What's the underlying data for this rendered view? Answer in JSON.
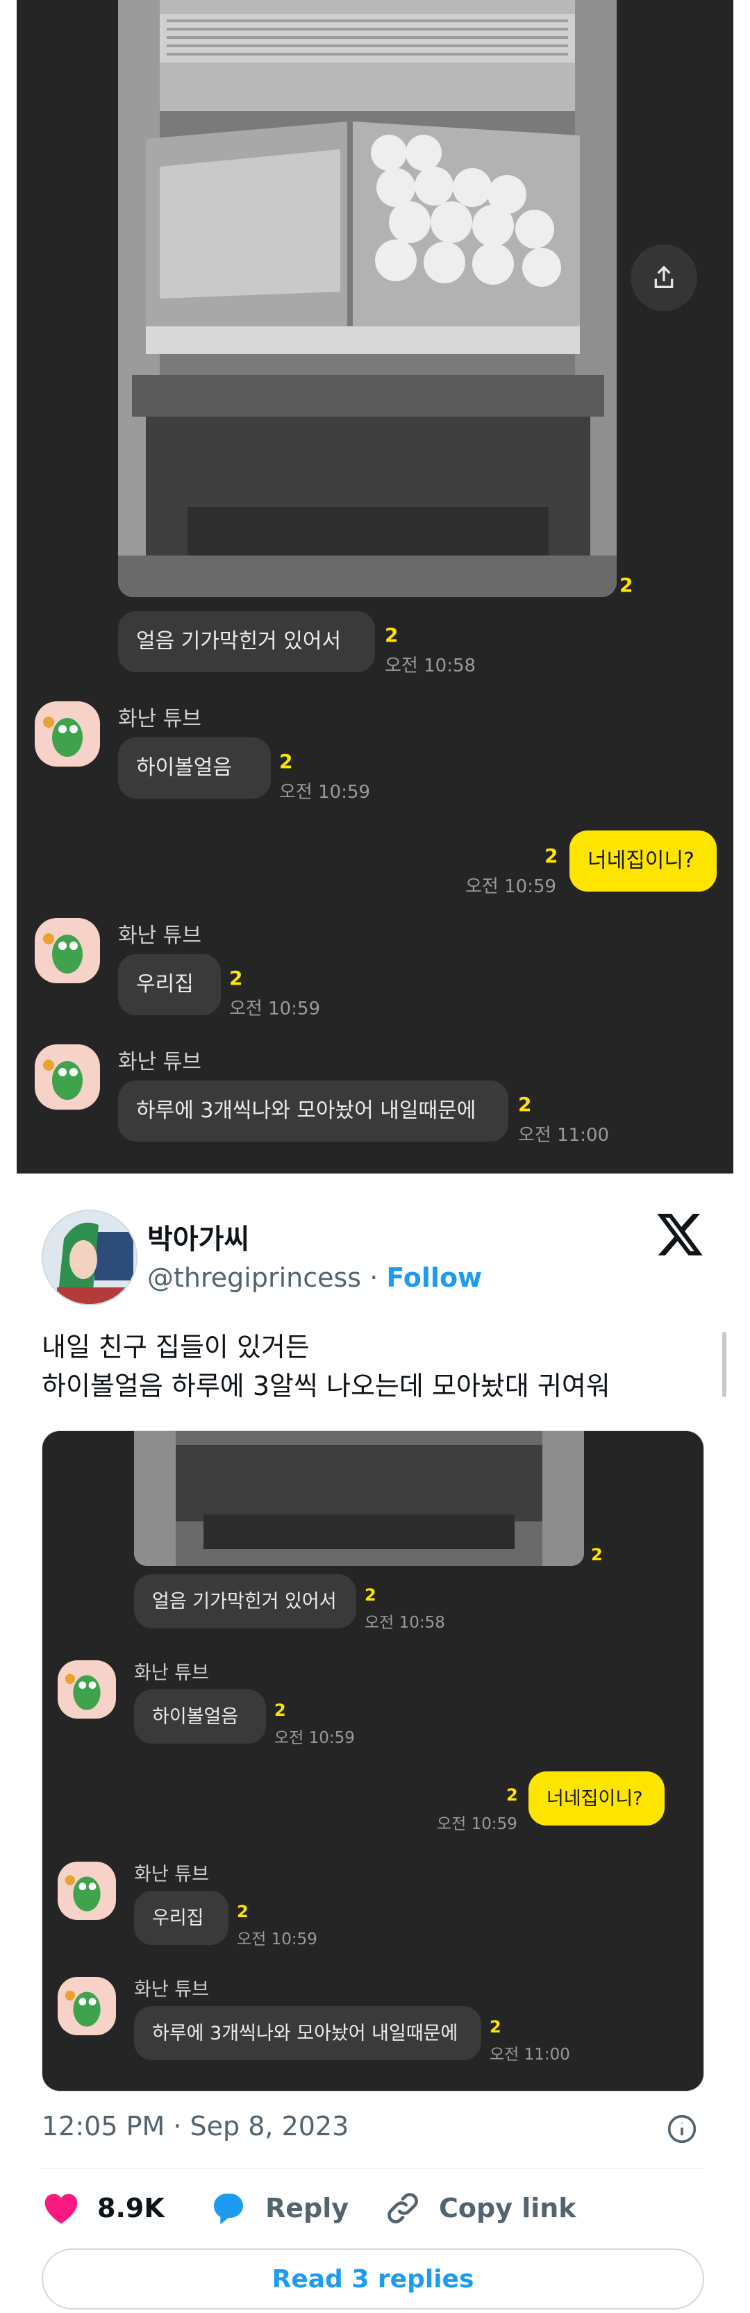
{
  "chat": {
    "photo_unread": "2",
    "messages": [
      {
        "text": "얼음 기가막힌거 있어서",
        "unread": "2",
        "time": "오전 10:58"
      },
      {
        "sender": "화난 튜브",
        "text": "하이볼얼음",
        "unread": "2",
        "time": "오전 10:59"
      },
      {
        "text": "너네집이니?",
        "unread": "2",
        "time": "오전 10:59",
        "mine": true
      },
      {
        "sender": "화난 튜브",
        "text": "우리집",
        "unread": "2",
        "time": "오전 10:59"
      },
      {
        "sender": "화난 튜브",
        "text": "하루에 3개씩나와 모아놨어 내일때문에",
        "unread": "2",
        "time": "오전 11:00"
      }
    ]
  },
  "tweet": {
    "display_name": "박아가씨",
    "handle": "@thregiprincess",
    "separator": "·",
    "follow_label": "Follow",
    "text_lines": [
      "내일 친구 집들이 있거든",
      "하이볼얼음 하루에 3알씩 나오는데 모아놨대 귀여워"
    ],
    "timestamp": "12:05 PM · Sep 8, 2023",
    "likes": "8.9K",
    "reply_label": "Reply",
    "copy_link_label": "Copy link",
    "read_replies_label": "Read 3 replies",
    "colors": {
      "like": "#f91880",
      "reply": "#1d9bf0",
      "accent": "#1d9bf0",
      "kakao_yellow": "#fee500"
    }
  },
  "icons": [
    "share-icon",
    "x-logo-icon",
    "info-icon",
    "heart-icon",
    "reply-bubble-icon",
    "link-icon"
  ]
}
